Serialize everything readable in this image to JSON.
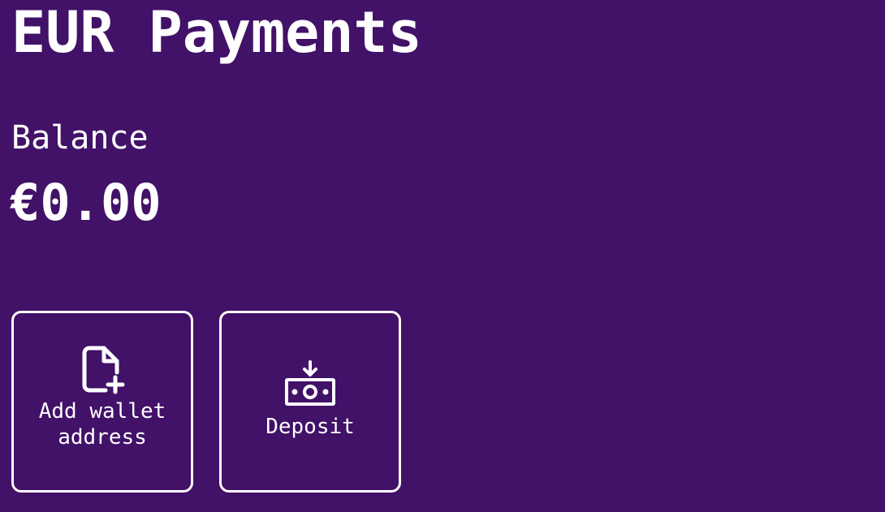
{
  "header": {
    "title": "EUR Payments"
  },
  "balance": {
    "label": "Balance",
    "amount": "€0.00"
  },
  "actions": [
    {
      "label": "Add wallet\naddress",
      "icon": "file-plus-icon"
    },
    {
      "label": "Deposit",
      "icon": "cash-deposit-icon"
    }
  ],
  "theme": {
    "background": "#421168",
    "foreground": "#ffffff"
  }
}
